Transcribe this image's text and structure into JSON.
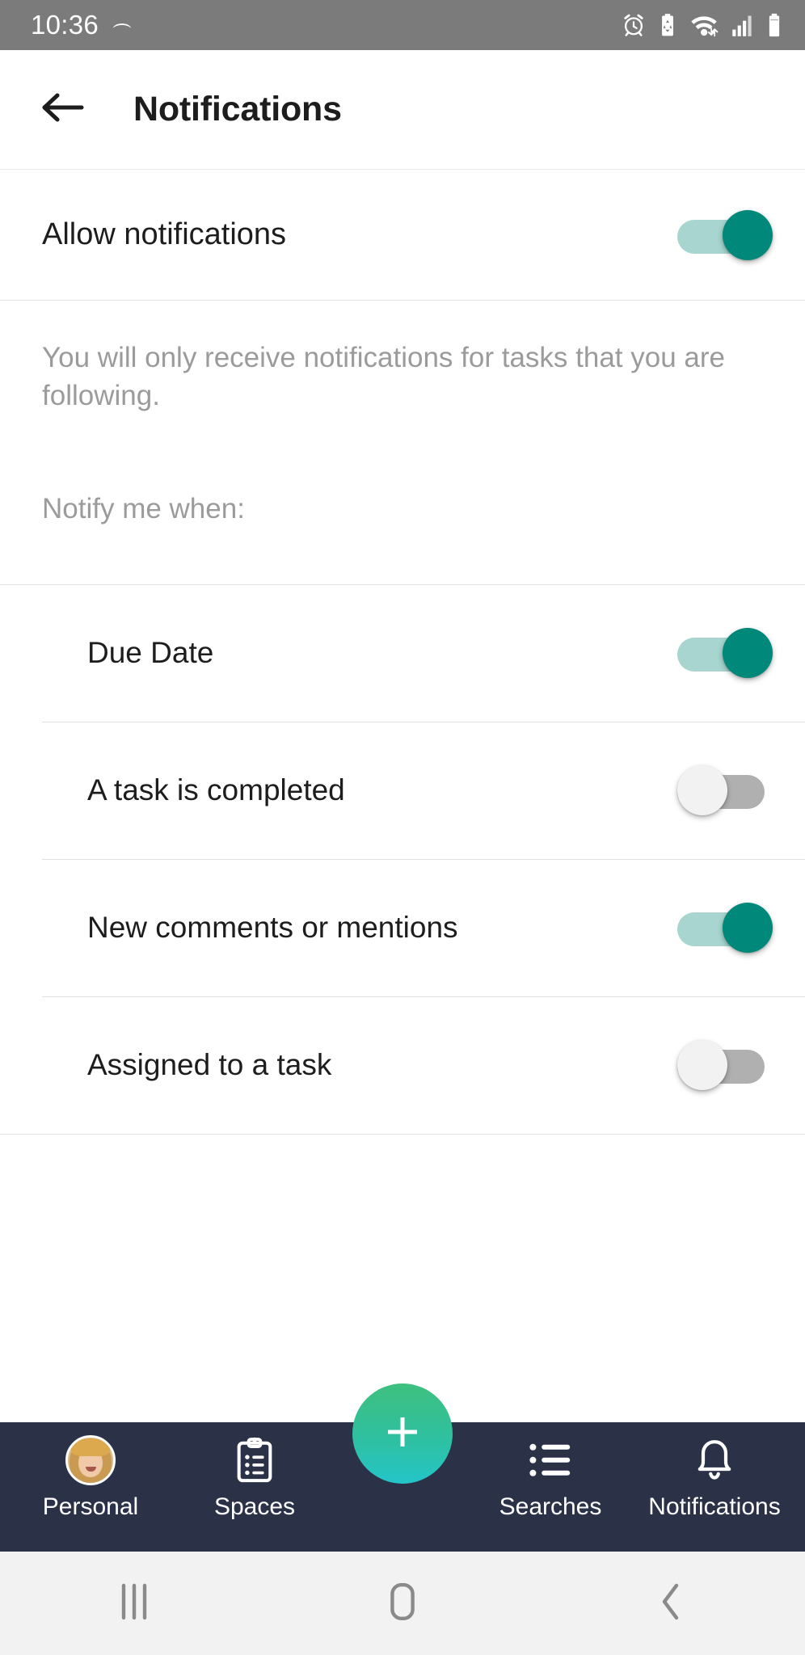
{
  "status_bar": {
    "time": "10:36",
    "icons_left": [
      "moon-crescent-icon"
    ],
    "icons_right": [
      "alarm-clock-icon",
      "battery-saver-icon",
      "wifi-transfer-icon",
      "signal-bars-icon",
      "battery-icon"
    ],
    "background_color": "#7b7b7b"
  },
  "header": {
    "back_icon": "back-arrow-icon",
    "title": "Notifications"
  },
  "master_setting": {
    "label": "Allow notifications",
    "enabled": true
  },
  "helper": {
    "text": "You will only receive notifications for tasks that you are following."
  },
  "section": {
    "label": "Notify me when:"
  },
  "settings_rows": [
    {
      "label": "Due Date",
      "enabled": true
    },
    {
      "label": "A task is completed",
      "enabled": false
    },
    {
      "label": "New comments or mentions",
      "enabled": true
    },
    {
      "label": "Assigned to a task",
      "enabled": false
    }
  ],
  "bottom_nav": {
    "background_color": "#2b3248",
    "items": [
      {
        "label": "Personal",
        "icon": "user-avatar-icon"
      },
      {
        "label": "Spaces",
        "icon": "clipboard-list-icon"
      },
      {
        "label": "Searches",
        "icon": "list-bullet-icon"
      },
      {
        "label": "Notifications",
        "icon": "bell-icon"
      }
    ],
    "fab": {
      "icon": "plus-icon",
      "gradient_from": "#3ec07e",
      "gradient_to": "#24c5c9"
    }
  },
  "system_nav": {
    "buttons": [
      "recents-icon",
      "home-icon",
      "back-chevron-icon"
    ]
  },
  "colors": {
    "accent_teal": "#00897b",
    "track_on": "#a8d5cf",
    "track_off": "#b0b0b0",
    "thumb_off": "#f2f2f2",
    "text_primary": "#1d1d1d",
    "text_secondary": "#9b9b9b"
  }
}
